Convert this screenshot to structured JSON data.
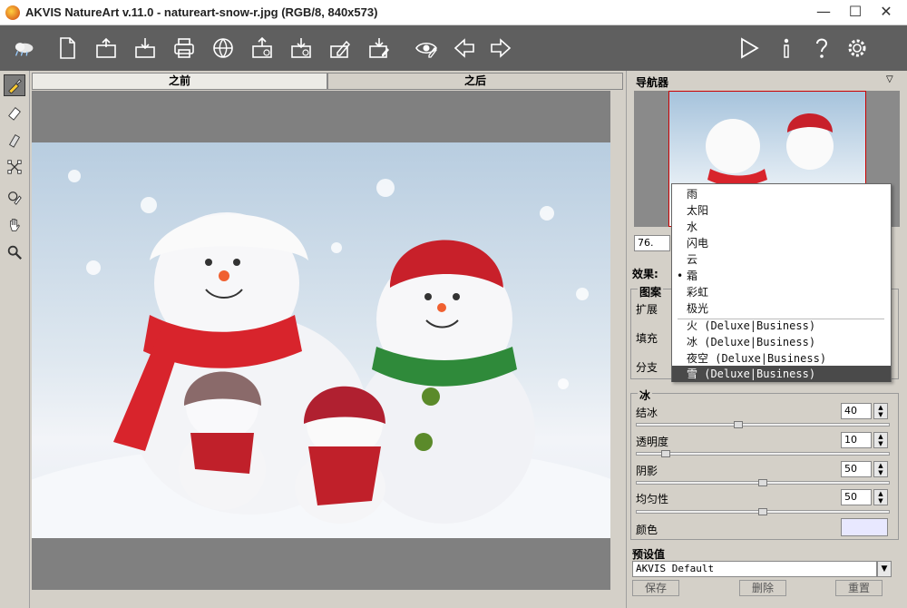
{
  "window": {
    "title": "AKVIS NatureArt v.11.0 - natureart-snow-r.jpg (RGB/8, 840x573)"
  },
  "window_controls": {
    "minimize": "—",
    "maximize": "☐",
    "close": "✕"
  },
  "toolbar": {
    "icons": [
      "app-logo",
      "new",
      "open",
      "save",
      "print",
      "share",
      "import",
      "export",
      "settings-doc",
      "edit-doc",
      "watch",
      "back",
      "forward",
      "run",
      "info",
      "help",
      "gear"
    ]
  },
  "tabs": {
    "before": "之前",
    "after": "之后"
  },
  "navigator": {
    "title": "导航器",
    "zoom": "76."
  },
  "effects": {
    "label": "效果:",
    "group_pattern": "图案",
    "expand": "扩展",
    "fill": "填充",
    "branch": "分支"
  },
  "dropdown": {
    "items": [
      "雨",
      "太阳",
      "水",
      "闪电",
      "云",
      "霜",
      "彩虹",
      "极光"
    ],
    "business_items": [
      "火 (Deluxe|Business)",
      "冰 (Deluxe|Business)",
      "夜空 (Deluxe|Business)",
      "雪 (Deluxe|Business)"
    ],
    "current": "霜",
    "highlighted": "雪 (Deluxe|Business)"
  },
  "ice": {
    "title": "冰",
    "freeze": {
      "label": "结冰",
      "value": "40",
      "fraction": 0.4
    },
    "transparency": {
      "label": "透明度",
      "value": "10",
      "fraction": 0.1
    },
    "shadow": {
      "label": "阴影",
      "value": "50",
      "fraction": 0.5
    },
    "uniformity": {
      "label": "均匀性",
      "value": "50",
      "fraction": 0.5
    },
    "color": {
      "label": "颜色",
      "value": "#e8e8ff"
    }
  },
  "presets": {
    "title": "预设值",
    "current": "AKVIS Default",
    "save": "保存",
    "delete": "删除",
    "reset": "重置"
  }
}
